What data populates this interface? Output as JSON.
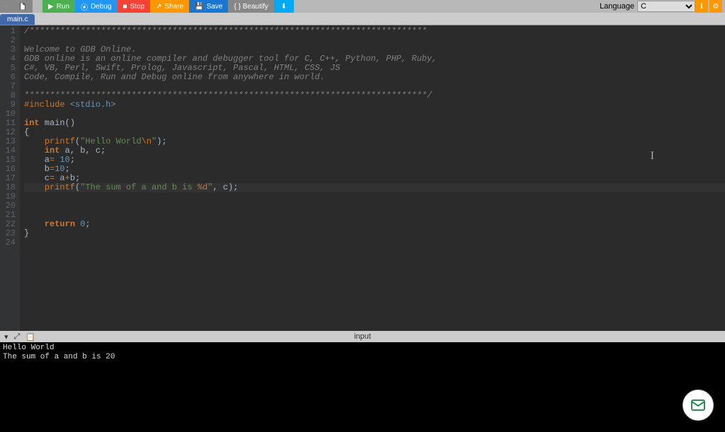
{
  "toolbar": {
    "run": "Run",
    "debug": "Debug",
    "stop": "Stop",
    "share": "Share",
    "save": "Save",
    "beautify": "{ } Beautify",
    "language_label": "Language",
    "language_value": "C"
  },
  "tabs": {
    "active": "main.c"
  },
  "editor": {
    "lines": [
      "/******************************************************************************",
      "",
      "Welcome to GDB Online.",
      "GDB online is an online compiler and debugger tool for C, C++, Python, PHP, Ruby,",
      "C#, VB, Perl, Swift, Prolog, Javascript, Pascal, HTML, CSS, JS",
      "Code, Compile, Run and Debug online from anywhere in world.",
      "",
      "*******************************************************************************/",
      "#include <stdio.h>",
      "",
      "int main()",
      "{",
      "    printf(\"Hello World\\n\");",
      "    int a, b, c;",
      "    a= 10;",
      "    b=10;",
      "    c= a+b;",
      "    printf(\"The sum of a and b is %d\", c);",
      "",
      "",
      "",
      "    return 0;",
      "}",
      ""
    ],
    "line_count": 24,
    "active_line": 18
  },
  "bottom": {
    "center_label": "input"
  },
  "console": {
    "output": "Hello World\nThe sum of a and b is 20"
  }
}
